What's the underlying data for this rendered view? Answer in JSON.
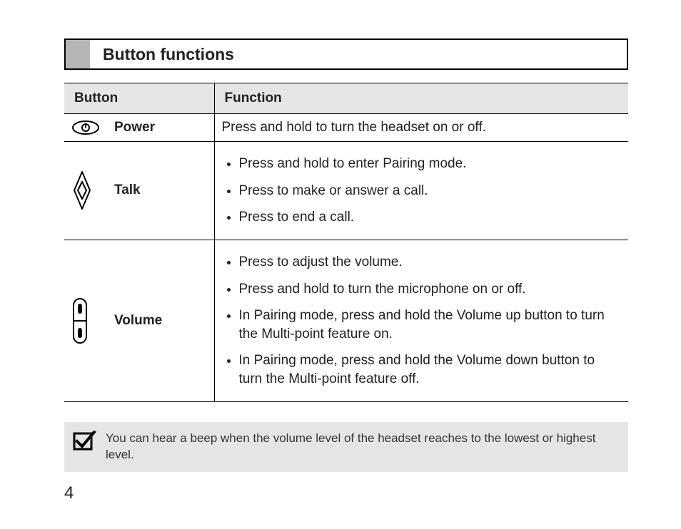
{
  "section_title": "Button functions",
  "table": {
    "headers": {
      "button": "Button",
      "function": "Function"
    },
    "rows": [
      {
        "name": "Power",
        "icon": "power-icon",
        "functions": [
          "Press and hold to turn the headset on or off."
        ]
      },
      {
        "name": "Talk",
        "icon": "talk-icon",
        "functions": [
          "Press and hold to enter Pairing mode.",
          "Press to make or answer a call.",
          "Press to end a call."
        ]
      },
      {
        "name": "Volume",
        "icon": "volume-icon",
        "functions": [
          "Press to adjust the volume.",
          "Press and hold to turn the microphone on or off.",
          "In Pairing mode, press and hold the Volume up button to turn the Multi-point feature on.",
          "In Pairing mode, press and hold the Volume down button to turn the Multi-point feature off."
        ]
      }
    ]
  },
  "note": "You can hear a beep when the volume level of the headset reaches to the lowest or highest level.",
  "page_number": "4"
}
